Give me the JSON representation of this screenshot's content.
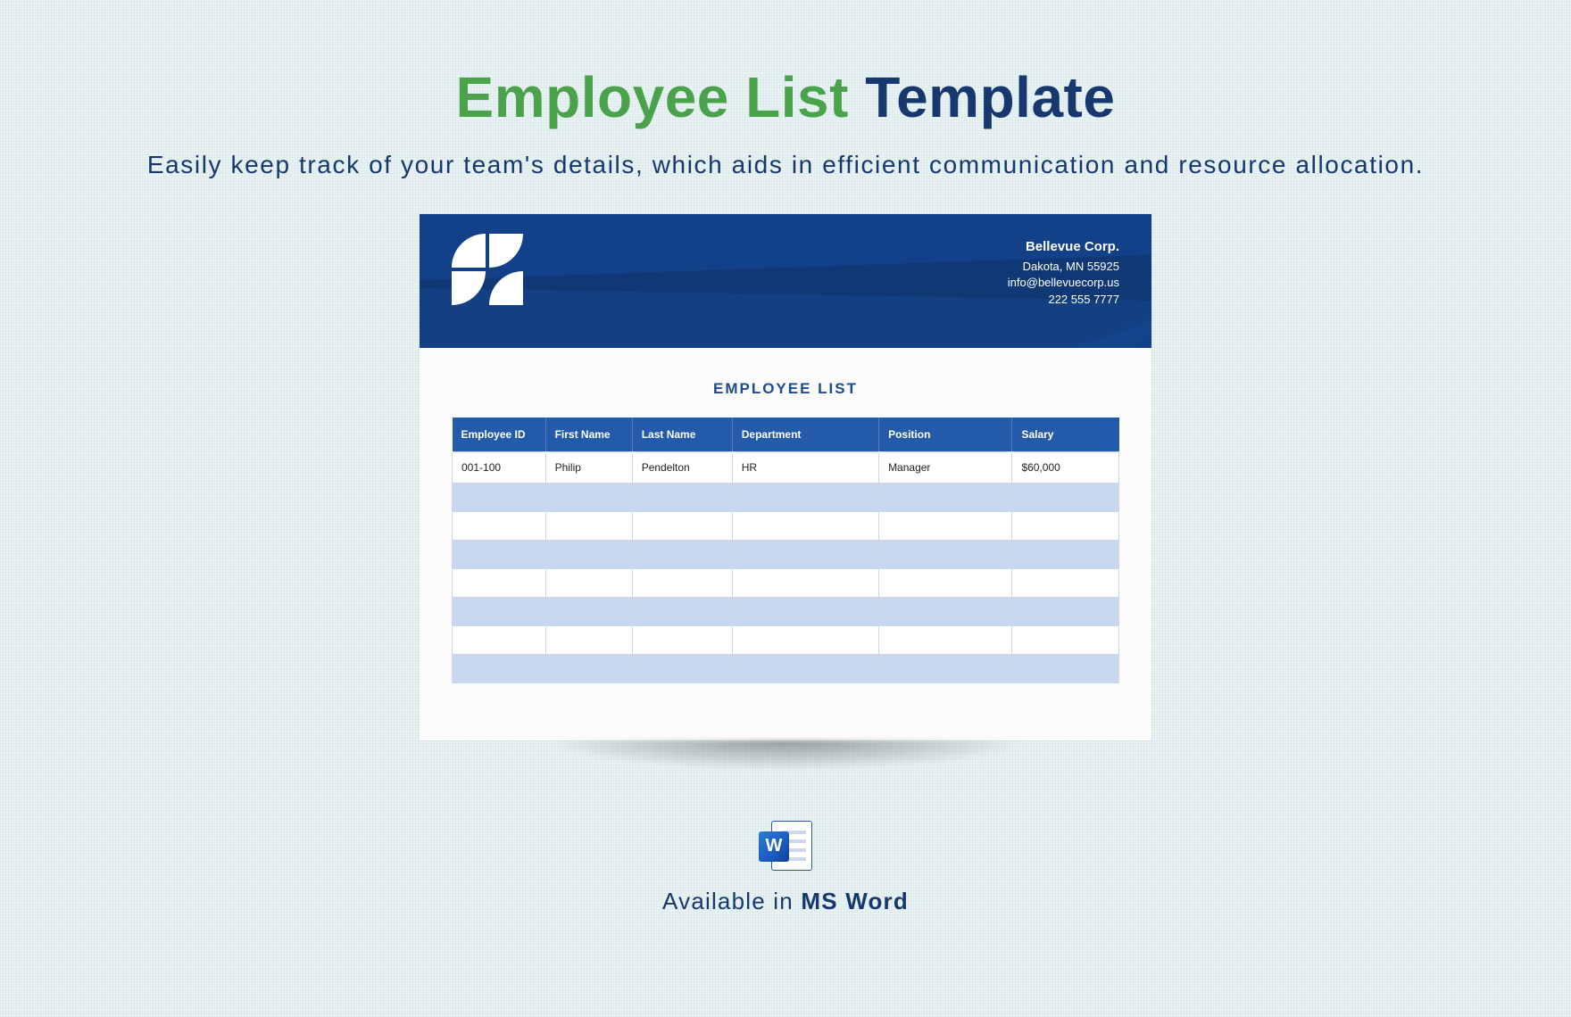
{
  "title": {
    "part1": "Employee List",
    "part2": "Template"
  },
  "subtitle": "Easily keep track of your team's details, which aids in efficient communication and resource allocation.",
  "company": {
    "name": "Bellevue Corp.",
    "address": "Dakota, MN 55925",
    "email": "info@bellevuecorp.us",
    "phone": "222 555 7777"
  },
  "list_title": "EMPLOYEE LIST",
  "columns": [
    "Employee ID",
    "First Name",
    "Last Name",
    "Department",
    "Position",
    "Salary"
  ],
  "rows": [
    [
      "001-100",
      "Philip",
      "Pendelton",
      "HR",
      "Manager",
      "$60,000"
    ],
    [
      "",
      "",
      "",
      "",
      "",
      ""
    ],
    [
      "",
      "",
      "",
      "",
      "",
      ""
    ],
    [
      "",
      "",
      "",
      "",
      "",
      ""
    ],
    [
      "",
      "",
      "",
      "",
      "",
      ""
    ],
    [
      "",
      "",
      "",
      "",
      "",
      ""
    ],
    [
      "",
      "",
      "",
      "",
      "",
      ""
    ],
    [
      "",
      "",
      "",
      "",
      "",
      ""
    ]
  ],
  "footer": {
    "prefix": "Available in ",
    "format": "MS Word"
  },
  "word_letter": "W"
}
